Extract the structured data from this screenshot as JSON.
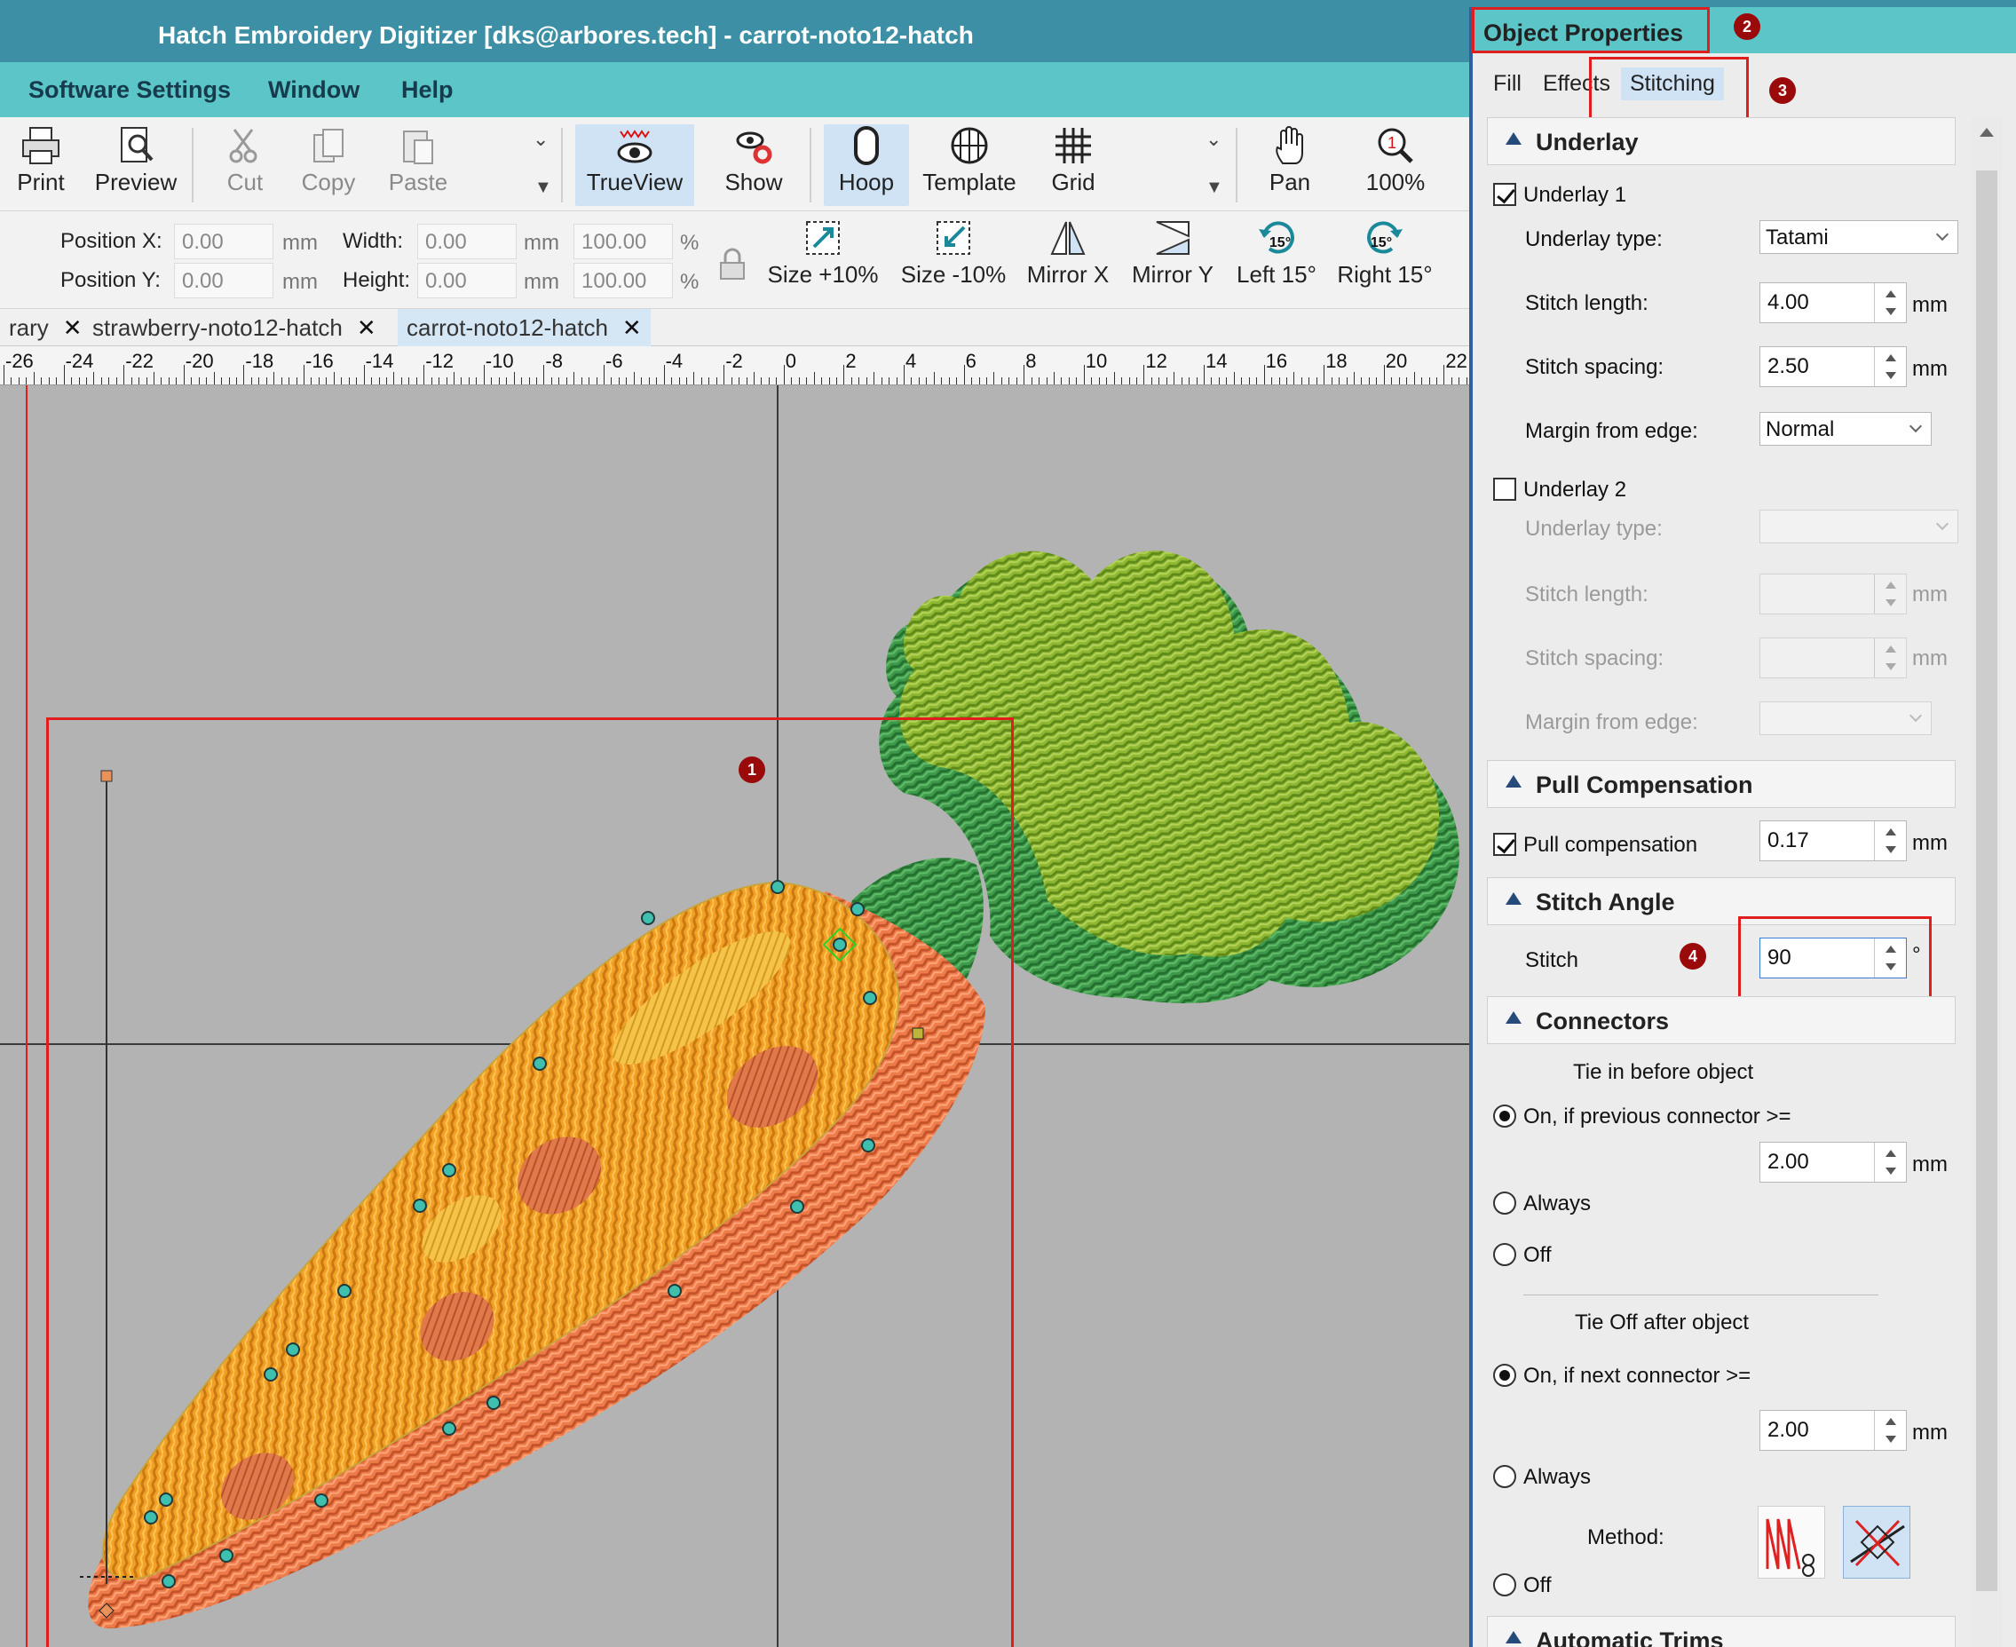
{
  "window": {
    "title": "Hatch Embroidery Digitizer [dks@arbores.tech] - carrot-noto12-hatch"
  },
  "menu": [
    "Software Settings",
    "Window",
    "Help"
  ],
  "toolbar": {
    "print": "Print",
    "preview": "Preview",
    "cut": "Cut",
    "copy": "Copy",
    "paste": "Paste",
    "trueview": "TrueView",
    "show": "Show",
    "hoop": "Hoop",
    "template": "Template",
    "grid": "Grid",
    "pan": "Pan",
    "zoom": "100%"
  },
  "propbar": {
    "pos_x_label": "Position X:",
    "pos_x": "0.00",
    "pos_y_label": "Position Y:",
    "pos_y": "0.00",
    "width_label": "Width:",
    "width": "0.00",
    "width_pct": "100.00",
    "height_label": "Height:",
    "height": "0.00",
    "height_pct": "100.00",
    "unit_mm": "mm",
    "unit_pct": "%",
    "size_up": "Size +10%",
    "size_down": "Size -10%",
    "mirror_x": "Mirror X",
    "mirror_y": "Mirror Y",
    "left15": "Left 15°",
    "right15": "Right 15°"
  },
  "tabs": [
    {
      "label": "rary"
    },
    {
      "label": "strawberry-noto12-hatch"
    },
    {
      "label": "carrot-noto12-hatch"
    }
  ],
  "ruler": [
    "-26",
    "-24",
    "-22",
    "-20",
    "-18",
    "-16",
    "-14",
    "-12",
    "-10",
    "-8",
    "-6",
    "-4",
    "-2",
    "0",
    "2",
    "4",
    "6",
    "8",
    "10",
    "12",
    "14",
    "16",
    "18",
    "20",
    "22"
  ],
  "panel": {
    "title": "Object Properties",
    "tabs": [
      "Fill",
      "Effects",
      "Stitching"
    ],
    "underlay": {
      "heading": "Underlay",
      "u1_label": "Underlay 1",
      "u1_checked": true,
      "type_label": "Underlay type:",
      "type_value": "Tatami",
      "len_label": "Stitch length:",
      "len_value": "4.00",
      "spacing_label": "Stitch spacing:",
      "spacing_value": "2.50",
      "margin_label": "Margin from edge:",
      "margin_value": "Normal",
      "u2_label": "Underlay 2",
      "u2_checked": false,
      "unit": "mm"
    },
    "pull": {
      "heading": "Pull Compensation",
      "label": "Pull compensation",
      "value": "0.17",
      "checked": true
    },
    "angle": {
      "heading": "Stitch Angle",
      "label": "Stitch",
      "value": "90",
      "unit": "°"
    },
    "connectors": {
      "heading": "Connectors",
      "tie_in_label": "Tie in before object",
      "tie_in_opt1": "On, if previous connector >=",
      "tie_in_value": "2.00",
      "always": "Always",
      "off": "Off",
      "tie_off_label": "Tie Off after object",
      "tie_off_opt1": "On, if next connector >=",
      "tie_off_value": "2.00",
      "method_label": "Method:"
    },
    "trims": {
      "heading": "Automatic Trims"
    }
  },
  "markers": [
    "1",
    "2",
    "3",
    "4"
  ],
  "colors": {
    "accent": "#e01e1e",
    "titlebar": "#3d8fa5",
    "menubar": "#5bc5c7",
    "canvas": "#b3b3b3"
  }
}
